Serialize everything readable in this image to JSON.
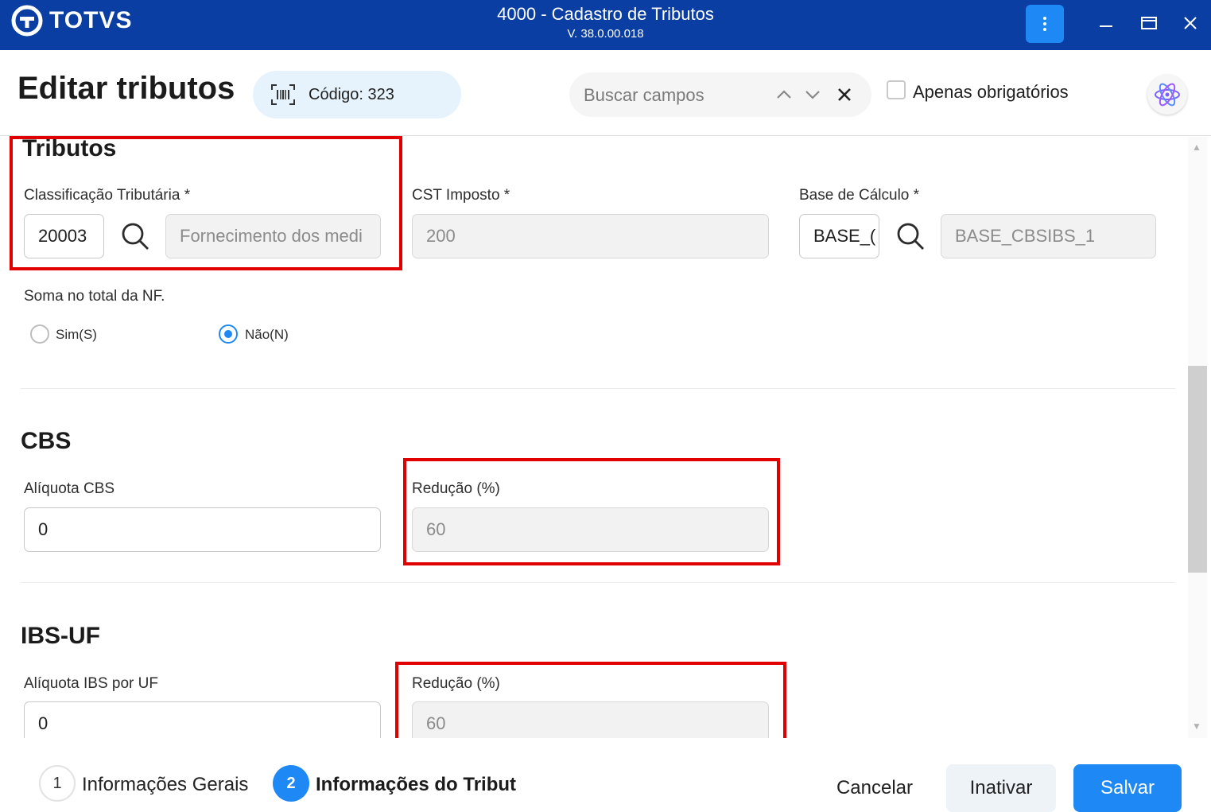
{
  "window": {
    "brand": "TOTVS",
    "title": "4000 - Cadastro de Tributos",
    "version": "V. 38.0.00.018"
  },
  "header": {
    "title": "Editar tributos",
    "code_label": "Código: 323",
    "search_placeholder": "Buscar campos",
    "only_required_label": "Apenas obrigatórios"
  },
  "sections": {
    "tributos": {
      "title": "Tributos",
      "classificacao_label": "Classificação Tributária *",
      "classificacao_code": "20003",
      "classificacao_desc": "Fornecimento dos medi",
      "cst_label": "CST Imposto *",
      "cst_value": "200",
      "base_label": "Base de Cálculo *",
      "base_code": "BASE_(",
      "base_desc": "BASE_CBSIBS_1",
      "soma_label": "Soma no total da NF.",
      "radio_sim": "Sim(S)",
      "radio_nao": "Não(N)",
      "selected": "Não(N)"
    },
    "cbs": {
      "title": "CBS",
      "aliquota_label": "Alíquota CBS",
      "aliquota_value": "0",
      "reducao_label": "Redução (%)",
      "reducao_value": "60"
    },
    "ibs_uf": {
      "title": "IBS-UF",
      "aliquota_label": "Alíquota IBS por UF",
      "aliquota_value": "0",
      "reducao_label": "Redução (%)",
      "reducao_value": "60"
    }
  },
  "footer": {
    "steps": [
      {
        "num": "1",
        "label": "Informações Gerais"
      },
      {
        "num": "2",
        "label": "Informações do Tribut"
      }
    ],
    "cancel_label": "Cancelar",
    "inactivate_label": "Inativar",
    "save_label": "Salvar"
  },
  "colors": {
    "titlebar": "#0A3EA2",
    "accent": "#1E88F5",
    "highlight": "#E00000"
  }
}
